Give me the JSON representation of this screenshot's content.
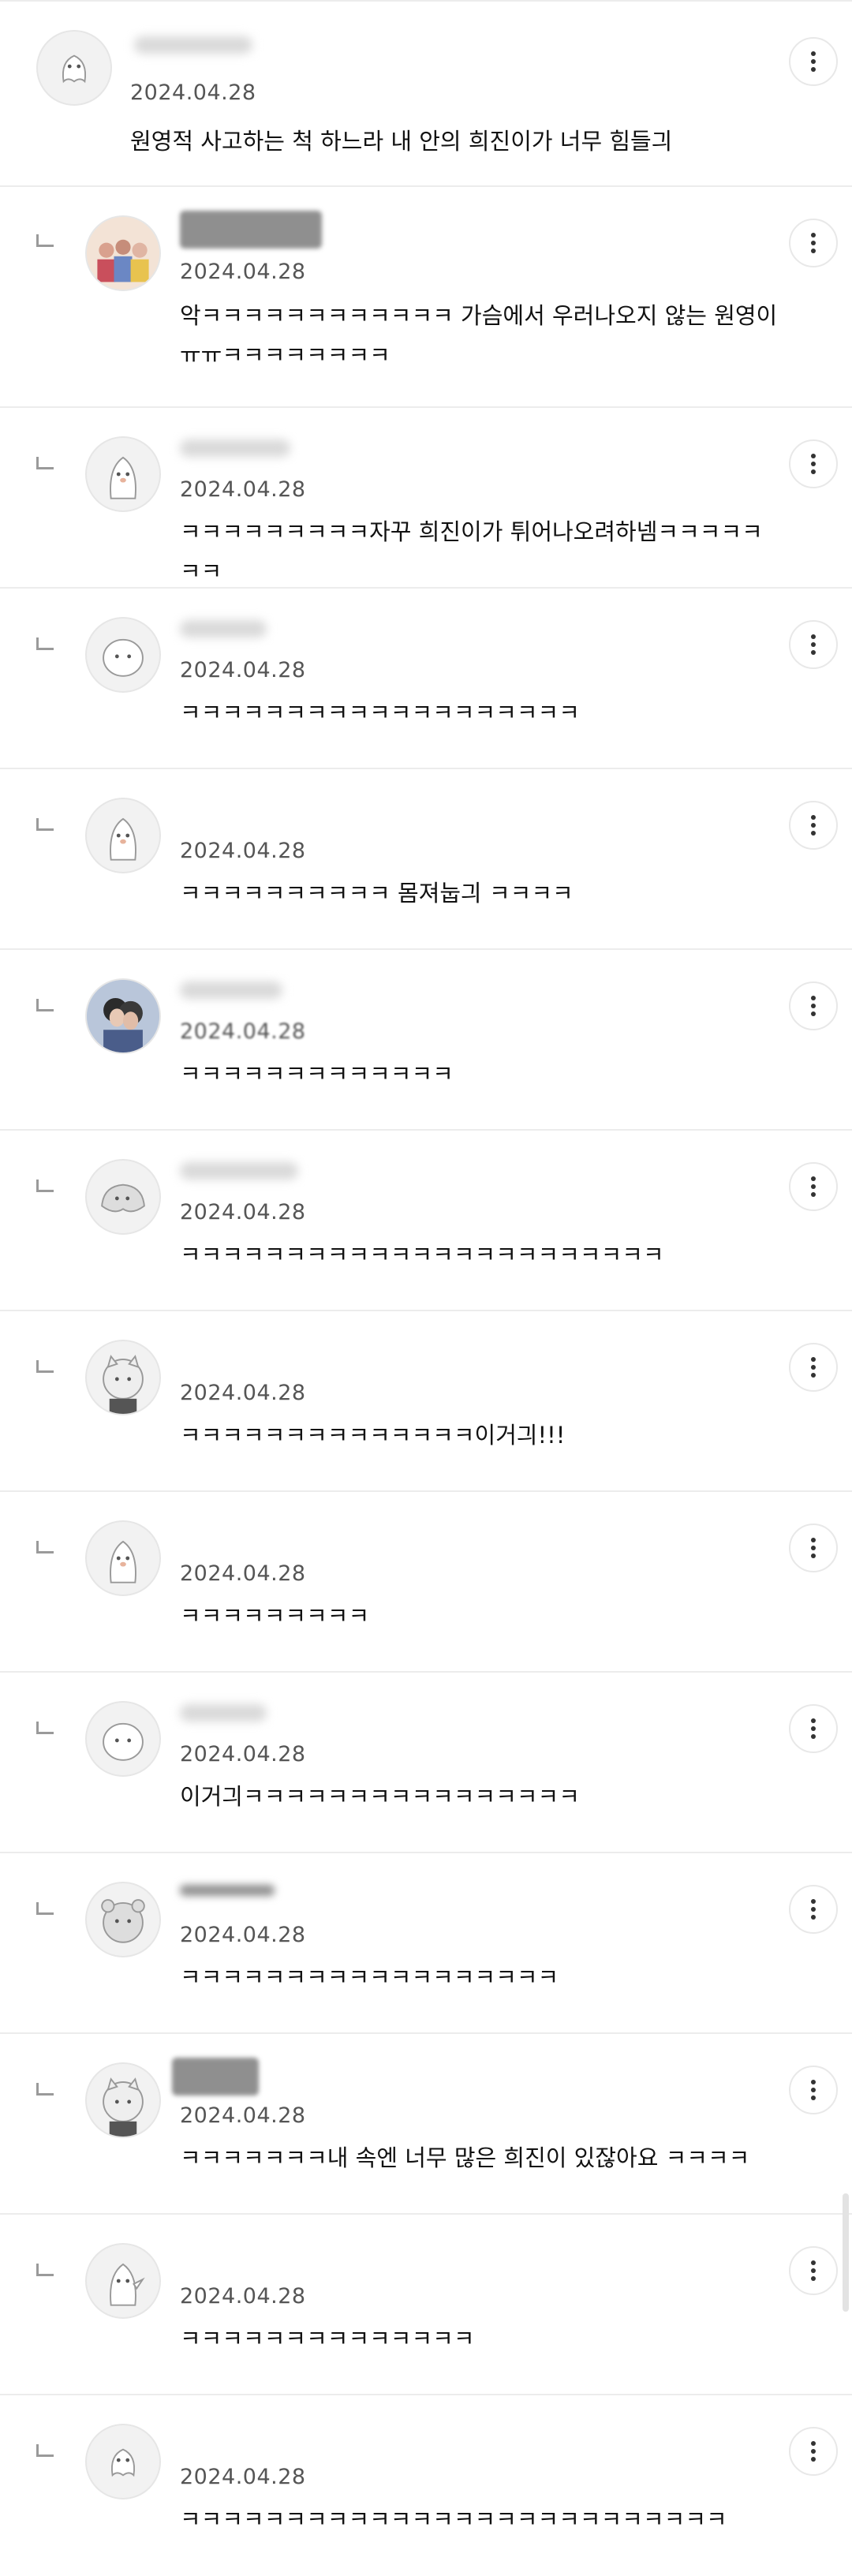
{
  "comments": [
    {
      "date": "2024.04.28",
      "text": "원영적 사고하는 척 하느라 내 안의 희진이가 너무 힘들긔"
    },
    {
      "date": "2024.04.28",
      "text": "악ㅋㅋㅋㅋㅋㅋㅋㅋㅋㅋㅋㅋ 가슴에서 우러나오지 않는 원영이ㅠㅠㅋㅋㅋㅋㅋㅋㅋㅋ"
    },
    {
      "date": "2024.04.28",
      "text": "ㅋㅋㅋㅋㅋㅋㅋㅋㅋ자꾸 희진이가 튀어나오려하넴ㅋㅋㅋㅋㅋㅋㅋ"
    },
    {
      "date": "2024.04.28",
      "text": "ㅋㅋㅋㅋㅋㅋㅋㅋㅋㅋㅋㅋㅋㅋㅋㅋㅋㅋㅋ"
    },
    {
      "date": "2024.04.28",
      "text": "ㅋㅋㅋㅋㅋㅋㅋㅋㅋㅋ 몸져눕긔 ㅋㅋㅋㅋ"
    },
    {
      "date": "2024.04.28",
      "text": "ㅋㅋㅋㅋㅋㅋㅋㅋㅋㅋㅋㅋㅋ"
    },
    {
      "date": "2024.04.28",
      "text": "ㅋㅋㅋㅋㅋㅋㅋㅋㅋㅋㅋㅋㅋㅋㅋㅋㅋㅋㅋㅋㅋㅋㅋ"
    },
    {
      "date": "2024.04.28",
      "text": "ㅋㅋㅋㅋㅋㅋㅋㅋㅋㅋㅋㅋㅋㅋ이거긔!!!"
    },
    {
      "date": "2024.04.28",
      "text": "ㅋㅋㅋㅋㅋㅋㅋㅋㅋ"
    },
    {
      "date": "2024.04.28",
      "text": "이거긔ㅋㅋㅋㅋㅋㅋㅋㅋㅋㅋㅋㅋㅋㅋㅋㅋ"
    },
    {
      "date": "2024.04.28",
      "text": "ㅋㅋㅋㅋㅋㅋㅋㅋㅋㅋㅋㅋㅋㅋㅋㅋㅋㅋ"
    },
    {
      "date": "2024.04.28",
      "text": "ㅋㅋㅋㅋㅋㅋㅋ내 속엔 너무 많은 희진이 있잖아요 ㅋㅋㅋㅋ"
    },
    {
      "date": "2024.04.28",
      "text": "ㅋㅋㅋㅋㅋㅋㅋㅋㅋㅋㅋㅋㅋㅋ"
    },
    {
      "date": "2024.04.28",
      "text": "ㅋㅋㅋㅋㅋㅋㅋㅋㅋㅋㅋㅋㅋㅋㅋㅋㅋㅋㅋㅋㅋㅋㅋㅋㅋㅋ"
    }
  ],
  "icons": {
    "more": "more-vertical-icon",
    "reply": "reply-arrow-icon",
    "avatar": "profile-avatar"
  },
  "colors": {
    "divider": "#ececec",
    "date": "#555555",
    "text": "#111111"
  }
}
